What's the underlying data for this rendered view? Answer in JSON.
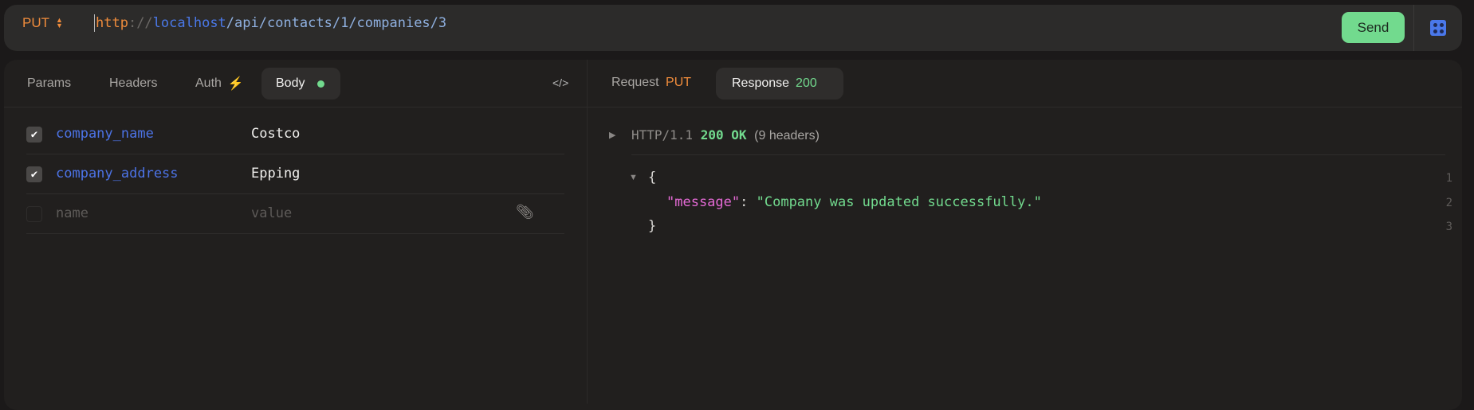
{
  "request_bar": {
    "method": "PUT",
    "url": {
      "scheme": "http",
      "sep": "://",
      "host": "localhost",
      "path": "/api/contacts/1/companies/3"
    },
    "send_label": "Send"
  },
  "request_tabs": [
    {
      "label": "Params"
    },
    {
      "label": "Headers"
    },
    {
      "label": "Auth"
    },
    {
      "label": "Body",
      "active": true
    }
  ],
  "body_rows": [
    {
      "checked": true,
      "name": "company_name",
      "value": "Costco"
    },
    {
      "checked": true,
      "name": "company_address",
      "value": "Epping"
    }
  ],
  "new_row": {
    "name_placeholder": "name",
    "value_placeholder": "value"
  },
  "response_tabs": {
    "request_label": "Request",
    "request_method": "PUT",
    "response_label": "Response",
    "response_status": "200"
  },
  "status_line": {
    "protocol": "HTTP/1.1",
    "status": "200 OK",
    "headers": "(9 headers)"
  },
  "response_body": {
    "open": "{",
    "key": "\"message\"",
    "colon": ":",
    "value": "\"Company was updated successfully.\"",
    "close": "}",
    "line_numbers": [
      "1",
      "2",
      "3"
    ]
  },
  "colors": {
    "accent_green": "#72da8e",
    "accent_orange": "#f08c3c",
    "accent_blue": "#4c73e6"
  }
}
